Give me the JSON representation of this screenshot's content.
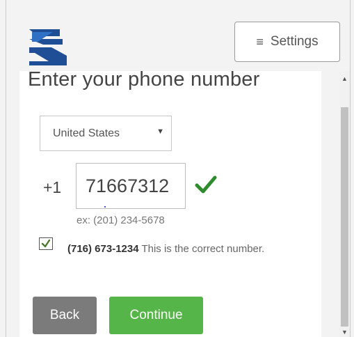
{
  "header": {
    "settings_label": "Settings",
    "settings_icon": "hamburger-menu-icon",
    "logo_icon": "brand-logo-icon"
  },
  "title": "Enter your phone number",
  "country_select": {
    "selected": "United States"
  },
  "phone": {
    "dial_code": "+1",
    "value": "71667312",
    "example": "ex: (201) 234-5678",
    "valid_icon": "checkmark-icon"
  },
  "confirm": {
    "checked": true,
    "number": "(716) 673-1234",
    "text": " This is the correct number."
  },
  "buttons": {
    "back": "Back",
    "continue": "Continue"
  },
  "colors": {
    "continue": "#56b548",
    "back": "#7b7b7b",
    "checkmark": "#2e8b2e",
    "logo": "#1f4e96"
  }
}
